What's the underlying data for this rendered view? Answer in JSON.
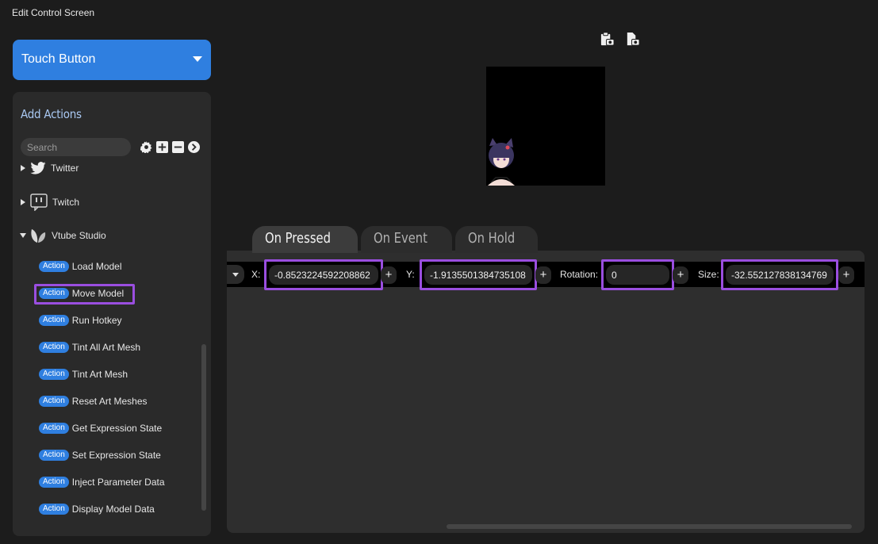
{
  "window": {
    "title": "Edit Control Screen"
  },
  "control_type": {
    "selected": "Touch Button"
  },
  "actions_panel": {
    "title": "Add Actions",
    "search_placeholder": "Search",
    "groups": [
      {
        "label": "Twitter",
        "icon": "twitter-icon",
        "expanded": false
      },
      {
        "label": "Twitch",
        "icon": "twitch-icon",
        "expanded": false
      },
      {
        "label": "Vtube Studio",
        "icon": "vtube-studio-icon",
        "expanded": true
      }
    ],
    "badge": "Action",
    "items": [
      "Load Model",
      "Move Model",
      "Run Hotkey",
      "Tint All Art Mesh",
      "Tint Art Mesh",
      "Reset Art Meshes",
      "Get Expression State",
      "Set Expression State",
      "Inject Parameter Data",
      "Display Model Data"
    ],
    "selected_item": "Move Model"
  },
  "tabs": [
    {
      "label": "On Pressed",
      "active": true
    },
    {
      "label": "On Event",
      "active": false
    },
    {
      "label": "On Hold",
      "active": false
    }
  ],
  "move_model": {
    "x": {
      "label": "X:",
      "value": "-0.8523224592208862"
    },
    "y": {
      "label": "Y:",
      "value": "-1.9135501384735108"
    },
    "rotation": {
      "label": "Rotation:",
      "value": "0"
    },
    "size": {
      "label": "Size:",
      "value": "-32.552127838134769"
    },
    "add_label": "+"
  },
  "colors": {
    "accent": "#2f7fe0",
    "highlight": "#9a4ee0",
    "background": "#1c1c1c"
  }
}
